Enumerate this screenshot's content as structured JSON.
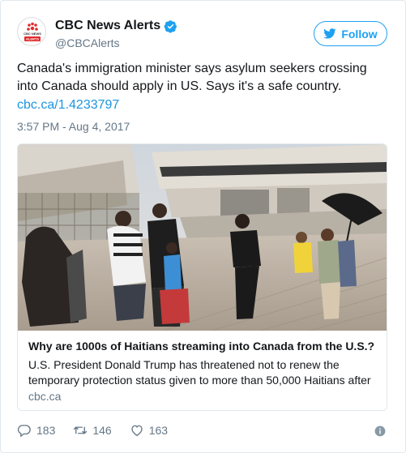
{
  "account": {
    "display_name": "CBC News Alerts",
    "handle": "@CBCAlerts",
    "avatar_text_top": "CBC NEWS",
    "avatar_text_bottom": "ALERTS"
  },
  "follow_button": {
    "label": "Follow"
  },
  "tweet": {
    "text": "Canada's immigration minister says asylum seekers crossing into Canada should apply in US. Says it's a safe country.",
    "link": "cbc.ca/1.4233797",
    "timestamp": "3:57 PM - Aug 4, 2017"
  },
  "card": {
    "title": "Why are 1000s of Haitians streaming into Canada from the U.S.?",
    "description": "U.S. President Donald Trump has threatened not to renew the temporary protection status given to more than 50,000 Haitians after",
    "domain": "cbc.ca"
  },
  "actions": {
    "replies": "183",
    "retweets": "146",
    "likes": "163"
  },
  "colors": {
    "accent": "#1da1f2",
    "link": "#1b95e0",
    "muted": "#657786",
    "cbc_red": "#e02b2b"
  },
  "icons": [
    "cbc-logo-icon",
    "verified-badge-icon",
    "twitter-bird-icon",
    "reply-icon",
    "retweet-icon",
    "like-icon",
    "info-icon"
  ]
}
